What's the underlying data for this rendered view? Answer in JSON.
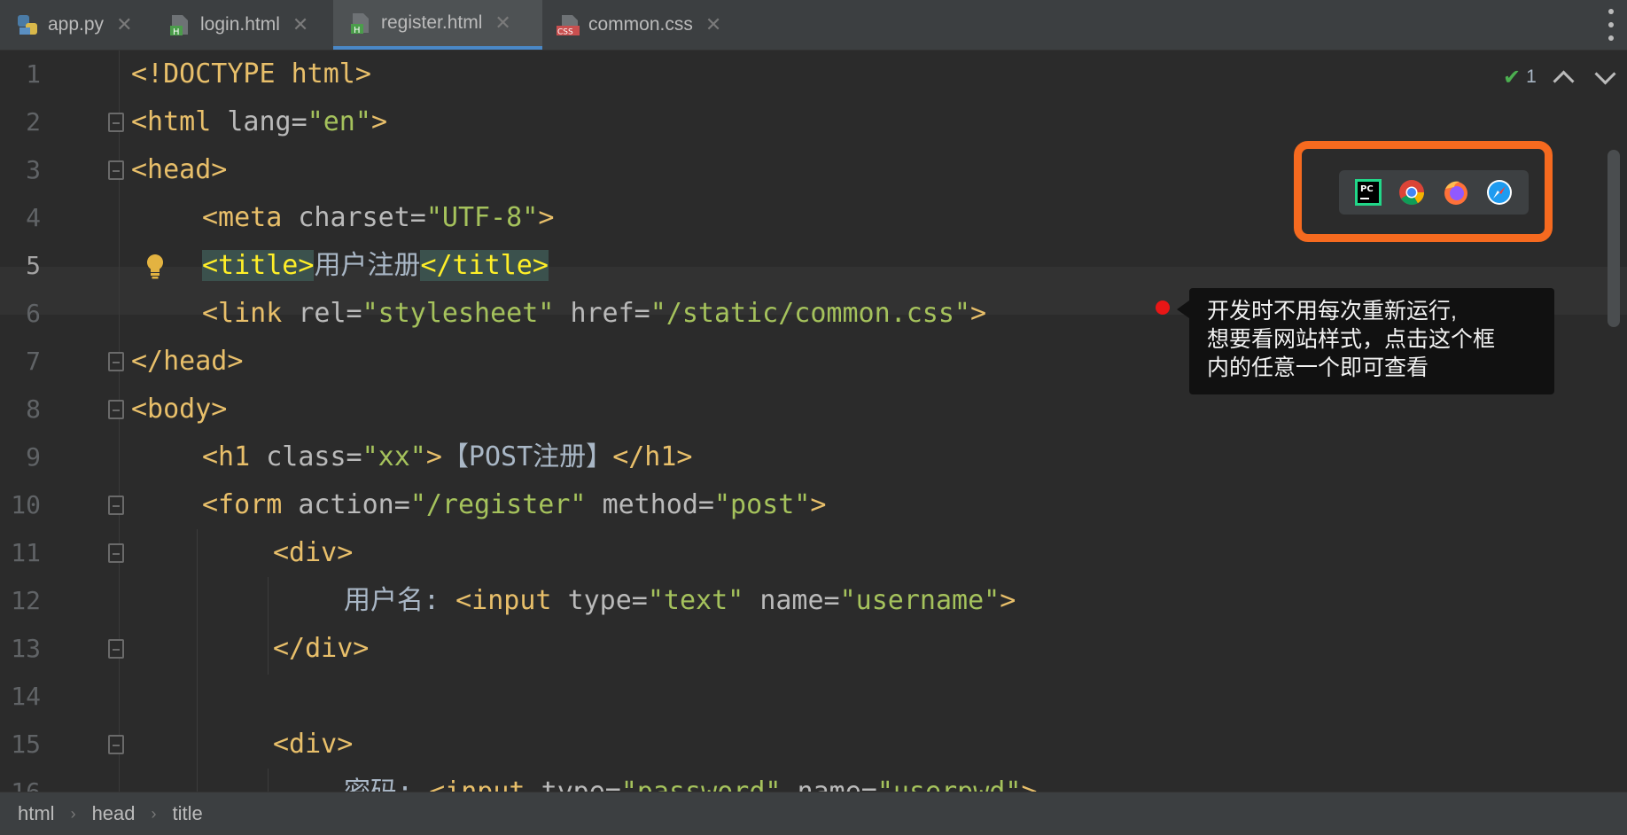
{
  "tabs": [
    {
      "label": "app.py",
      "icon": "python-file-icon",
      "active": false
    },
    {
      "label": "login.html",
      "icon": "html-file-icon",
      "active": false
    },
    {
      "label": "register.html",
      "icon": "html-file-icon",
      "active": true
    },
    {
      "label": "common.css",
      "icon": "css-file-icon",
      "active": false
    }
  ],
  "inspection": {
    "count": "1"
  },
  "code": {
    "l1": {
      "a": "<!DOCTYPE html>"
    },
    "l2": {
      "a": "<html ",
      "b": "lang=",
      "c": "\"en\"",
      "d": ">"
    },
    "l3": {
      "a": "<head>"
    },
    "l4": {
      "a": "<meta ",
      "b": "charset=",
      "c": "\"UTF-8\"",
      "d": ">"
    },
    "l5": {
      "a": "<title>",
      "b": "用户注册",
      "c": "</title>"
    },
    "l6": {
      "a": "<link ",
      "b": "rel=",
      "c": "\"stylesheet\" ",
      "d": "href=",
      "e": "\"/static/common.css\"",
      "f": ">"
    },
    "l7": {
      "a": "</head>"
    },
    "l8": {
      "a": "<body>"
    },
    "l9": {
      "a": "<h1 ",
      "b": "class=",
      "c": "\"xx\"",
      "d": ">",
      "e": "【POST注册】",
      "f": "</h1>"
    },
    "l10": {
      "a": "<form ",
      "b": "action=",
      "c": "\"/register\" ",
      "d": "method=",
      "e": "\"post\"",
      "f": ">"
    },
    "l11": {
      "a": "<div>"
    },
    "l12": {
      "a": "用户名: ",
      "b": "<input ",
      "c": "type=",
      "d": "\"text\" ",
      "e": "name=",
      "f": "\"username\"",
      "g": ">"
    },
    "l13": {
      "a": "</div>"
    },
    "l15": {
      "a": "<div>"
    },
    "l16": {
      "a": "密码: ",
      "b": "<input ",
      "c": "type=",
      "d": "\"password\" ",
      "e": "name=",
      "f": "\"userpwd\"",
      "g": ">"
    }
  },
  "annotation": {
    "line1": "开发时不用每次重新运行,",
    "line2": "想要看网站样式，点击这个框",
    "line3": "内的任意一个即可查看"
  },
  "browsers": [
    "pycharm-icon",
    "chrome-icon",
    "firefox-icon",
    "safari-icon"
  ],
  "breadcrumb": [
    "html",
    "head",
    "title"
  ],
  "colors": {
    "highlight_box": "#f66a1f",
    "annotation_dot": "#e81616",
    "active_tab_underline": "#4a88c7"
  }
}
